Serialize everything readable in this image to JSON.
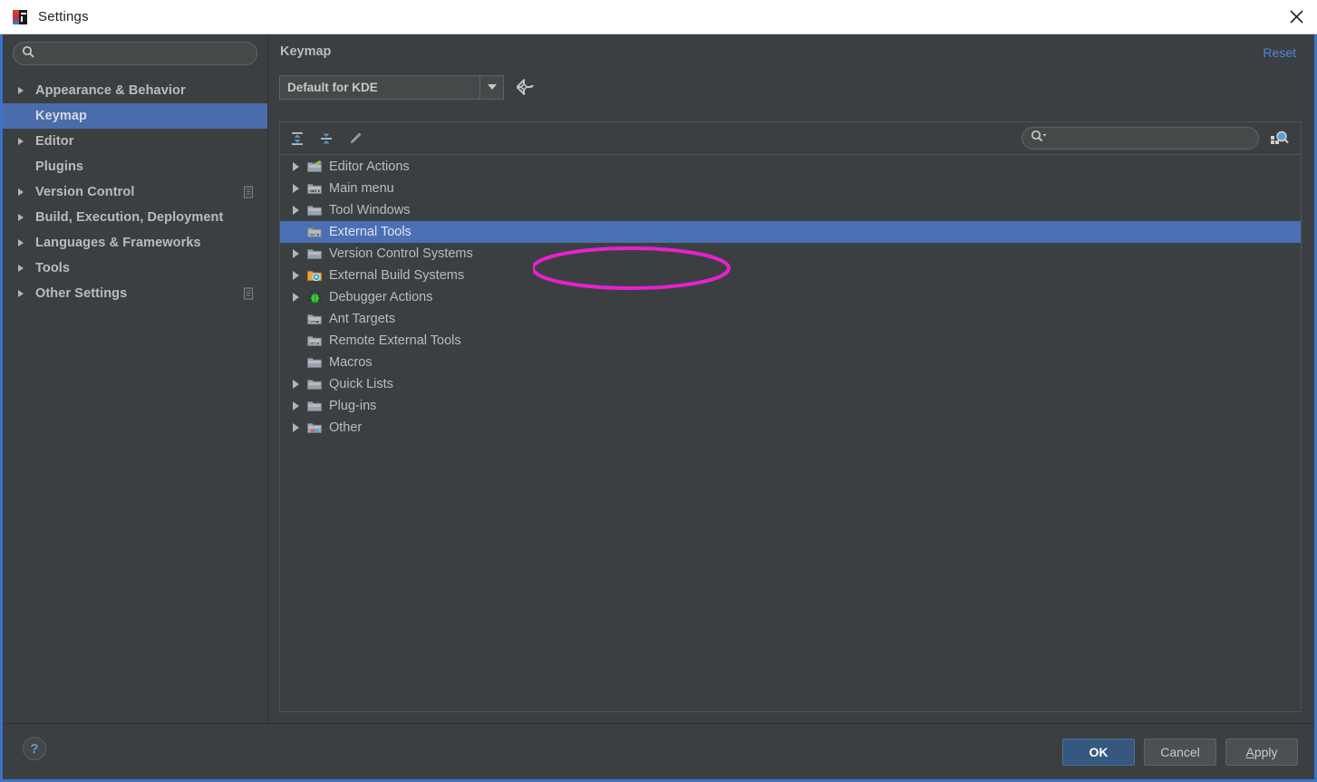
{
  "window": {
    "title": "Settings",
    "app_icon": "intellij-idea-icon",
    "close_icon": "close-icon"
  },
  "sidebar": {
    "search": {
      "value": "",
      "placeholder": "",
      "icon": "search-icon"
    },
    "items": [
      {
        "label": "Appearance & Behavior",
        "expandable": true,
        "selected": false,
        "badge": false
      },
      {
        "label": "Keymap",
        "expandable": false,
        "selected": true,
        "badge": false
      },
      {
        "label": "Editor",
        "expandable": true,
        "selected": false,
        "badge": false
      },
      {
        "label": "Plugins",
        "expandable": false,
        "selected": false,
        "badge": false
      },
      {
        "label": "Version Control",
        "expandable": true,
        "selected": false,
        "badge": true
      },
      {
        "label": "Build, Execution, Deployment",
        "expandable": true,
        "selected": false,
        "badge": false
      },
      {
        "label": "Languages & Frameworks",
        "expandable": true,
        "selected": false,
        "badge": false
      },
      {
        "label": "Tools",
        "expandable": true,
        "selected": false,
        "badge": false
      },
      {
        "label": "Other Settings",
        "expandable": true,
        "selected": false,
        "badge": true
      }
    ]
  },
  "main": {
    "page_title": "Keymap",
    "reset_label": "Reset",
    "keymap_combo": {
      "value": "Default for KDE",
      "dropdown_icon": "chevron-down-icon",
      "options": [
        "Default for KDE"
      ]
    },
    "gear_icon": "gear-dropdown-icon",
    "toolbar": {
      "expand_all_icon": "expand-all-icon",
      "collapse_all_icon": "collapse-all-icon",
      "edit_shortcut_icon": "pencil-edit-icon",
      "search_field": {
        "value": "",
        "placeholder": "",
        "icon": "search-dropdown-icon"
      },
      "find_shortcut_icon": "find-by-shortcut-icon"
    },
    "tree": [
      {
        "label": "Editor Actions",
        "expandable": true,
        "selected": false,
        "icon": "editor-actions-icon"
      },
      {
        "label": "Main menu",
        "expandable": true,
        "selected": false,
        "icon": "main-menu-icon"
      },
      {
        "label": "Tool Windows",
        "expandable": true,
        "selected": false,
        "icon": "folder-icon"
      },
      {
        "label": "External Tools",
        "expandable": false,
        "selected": true,
        "icon": "external-tools-icon"
      },
      {
        "label": "Version Control Systems",
        "expandable": true,
        "selected": false,
        "icon": "folder-icon"
      },
      {
        "label": "External Build Systems",
        "expandable": true,
        "selected": false,
        "icon": "build-systems-icon"
      },
      {
        "label": "Debugger Actions",
        "expandable": true,
        "selected": false,
        "icon": "debugger-bug-icon"
      },
      {
        "label": "Ant Targets",
        "expandable": false,
        "selected": false,
        "icon": "ant-targets-icon"
      },
      {
        "label": "Remote External Tools",
        "expandable": false,
        "selected": false,
        "icon": "remote-external-tools-icon"
      },
      {
        "label": "Macros",
        "expandable": false,
        "selected": false,
        "icon": "folder-icon"
      },
      {
        "label": "Quick Lists",
        "expandable": true,
        "selected": false,
        "icon": "folder-icon"
      },
      {
        "label": "Plug-ins",
        "expandable": true,
        "selected": false,
        "icon": "folder-icon"
      },
      {
        "label": "Other",
        "expandable": true,
        "selected": false,
        "icon": "other-icon"
      }
    ]
  },
  "footer": {
    "help_label": "?",
    "ok_label": "OK",
    "cancel_label": "Cancel",
    "apply_label_mnemonic": "A",
    "apply_label_rest": "pply"
  },
  "annotation": {
    "shape": "ellipse",
    "color": "#e820d0",
    "target": "External Tools"
  },
  "colors": {
    "window_bg": "#3c3f41",
    "selection_blue": "#4a6fb5",
    "sidebar_selection": "#4a6cab",
    "accent_link": "#4e87d4",
    "primary_button": "#365880",
    "window_border": "#3a74c8",
    "annotation": "#e820d0"
  }
}
